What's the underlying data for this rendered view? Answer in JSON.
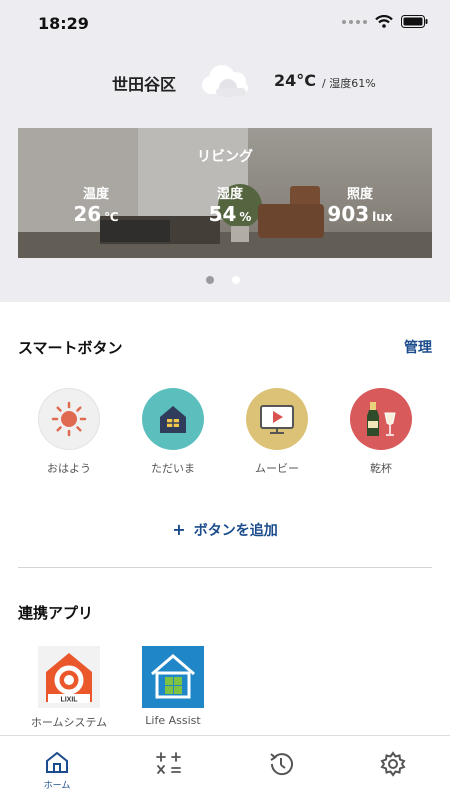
{
  "status_bar": {
    "time": "18:29"
  },
  "weather": {
    "location": "世田谷区",
    "temperature": "24°C",
    "humidity_text": "/ 湿度61%",
    "icon": "cloud-icon"
  },
  "room": {
    "name": "リビング",
    "metrics": [
      {
        "label": "温度",
        "value": "26",
        "unit": "℃"
      },
      {
        "label": "湿度",
        "value": "54",
        "unit": "%"
      },
      {
        "label": "照度",
        "value": "903",
        "unit": "lux"
      }
    ],
    "pager": {
      "count": 2,
      "active_index": 1
    }
  },
  "smart_buttons": {
    "title": "スマートボタン",
    "manage_label": "管理",
    "items": [
      {
        "label": "おはよう",
        "icon": "sun-icon",
        "color": "#f0f0f0"
      },
      {
        "label": "ただいま",
        "icon": "house-icon",
        "color": "#5bbfbd"
      },
      {
        "label": "ムービー",
        "icon": "movie-icon",
        "color": "#dcc276"
      },
      {
        "label": "乾杯",
        "icon": "champagne-icon",
        "color": "#d85a5a"
      }
    ],
    "add_label": "ボタンを追加"
  },
  "linked_apps": {
    "title": "連携アプリ",
    "items": [
      {
        "label": "ホームシステム",
        "icon": "lixil-logo-icon",
        "logo_text": "LIXIL"
      },
      {
        "label": "Life Assist",
        "icon": "life-assist-icon"
      }
    ]
  },
  "tabbar": {
    "tabs": [
      {
        "label": "ホーム",
        "icon": "home-icon",
        "active": true
      },
      {
        "label": "",
        "icon": "calculator-icon",
        "active": false
      },
      {
        "label": "",
        "icon": "history-icon",
        "active": false
      },
      {
        "label": "",
        "icon": "gear-icon",
        "active": false
      }
    ]
  },
  "colors": {
    "accent": "#1a4b8c",
    "top_background": "#ececf1"
  }
}
